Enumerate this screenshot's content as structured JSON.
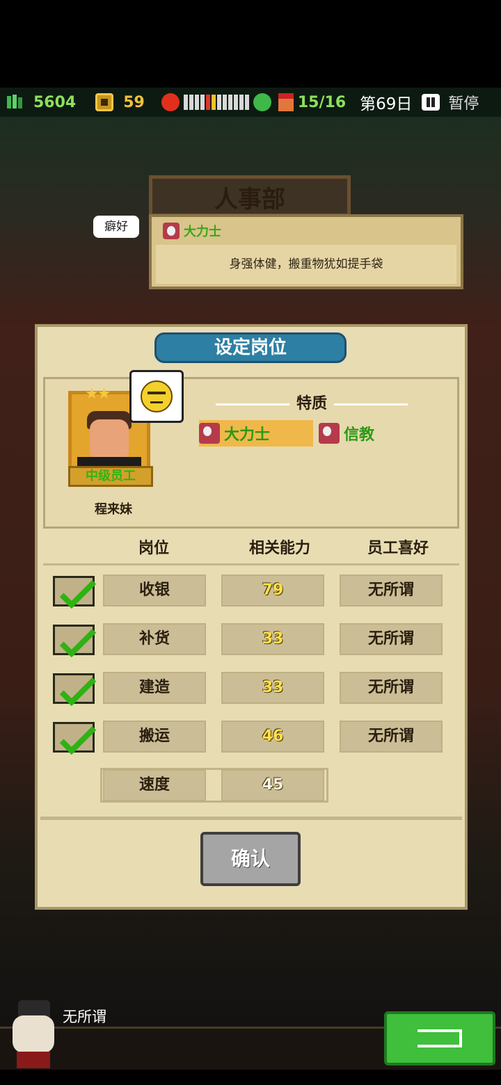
{
  "status": {
    "money": "5604",
    "coins": "59",
    "staff": "15/16",
    "day": "第69日",
    "pause_label": "暂停",
    "colors": {
      "money": "#8de05a",
      "mood_bad": "#e0301c",
      "mood_good": "#3fb84a"
    }
  },
  "backdrop": {
    "sign": "人事部"
  },
  "trait_popup": {
    "hobby_label": "癖好",
    "trait_name": "大力士",
    "description": "身强体健，搬重物犹如提手袋"
  },
  "panel": {
    "title": "设定岗位",
    "employee": {
      "name": "程来妹",
      "rank": "中级员工",
      "stars": "★★",
      "traits_label": "特质",
      "traits": [
        "大力士",
        "信教"
      ]
    },
    "columns": [
      "岗位",
      "相关能力",
      "员工喜好"
    ],
    "rows": [
      {
        "role": "收银",
        "score": "79",
        "pref": "无所谓"
      },
      {
        "role": "补货",
        "score": "33",
        "pref": "无所谓"
      },
      {
        "role": "建造",
        "score": "33",
        "pref": "无所谓"
      },
      {
        "role": "搬运",
        "score": "46",
        "pref": "无所谓"
      }
    ],
    "speed": {
      "label": "速度",
      "value": "45"
    },
    "confirm": "确认"
  },
  "bottom": {
    "speech": "无所谓"
  }
}
